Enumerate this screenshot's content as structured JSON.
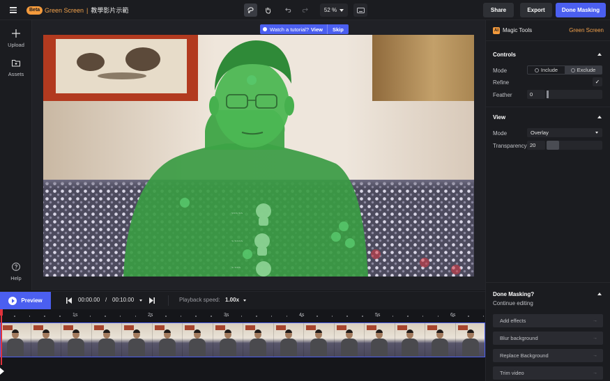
{
  "header": {
    "beta_label": "Beta",
    "app_label": "Green Screen",
    "separator": "|",
    "project_name": "教學影片示範",
    "zoom_level": "52 %",
    "share_label": "Share",
    "export_label": "Export",
    "done_label": "Done Masking"
  },
  "rail": {
    "upload_label": "Upload",
    "assets_label": "Assets",
    "help_label": "Help"
  },
  "tutorial": {
    "text": "Watch a tutorial?",
    "view_label": "View",
    "skip_label": "Skip"
  },
  "panel": {
    "ai_badge": "AI",
    "magic_tools": "Magic Tools",
    "green_screen": "Green Screen",
    "controls_title": "Controls",
    "mode_label": "Mode",
    "include_label": "Include",
    "exclude_label": "Exclude",
    "selected_mode": "Exclude",
    "refine_label": "Refine",
    "refine_checked": true,
    "feather_label": "Feather",
    "feather_value": "0",
    "view_title": "View",
    "view_mode_label": "Mode",
    "view_mode_value": "Overlay",
    "transparency_label": "Transparency",
    "transparency_value": "20",
    "done_title": "Done Masking?",
    "continue_label": "Continue editing",
    "actions": [
      "Add effects",
      "Blur background",
      "Replace Background",
      "Trim video"
    ]
  },
  "timeline": {
    "preview_label": "Preview",
    "current_time": "00:00.00",
    "time_sep": "/",
    "total_time": "00:10.00",
    "speed_label": "Playback speed:",
    "speed_value": "1.00x",
    "ticks": [
      "1s",
      "2s",
      "3s",
      "4s",
      "5s",
      "6s"
    ]
  },
  "colors": {
    "accent": "#4b5ff0",
    "beta_orange": "#f39a3c",
    "mask_green": "#3fae4a",
    "playhead_red": "#e0323c"
  }
}
